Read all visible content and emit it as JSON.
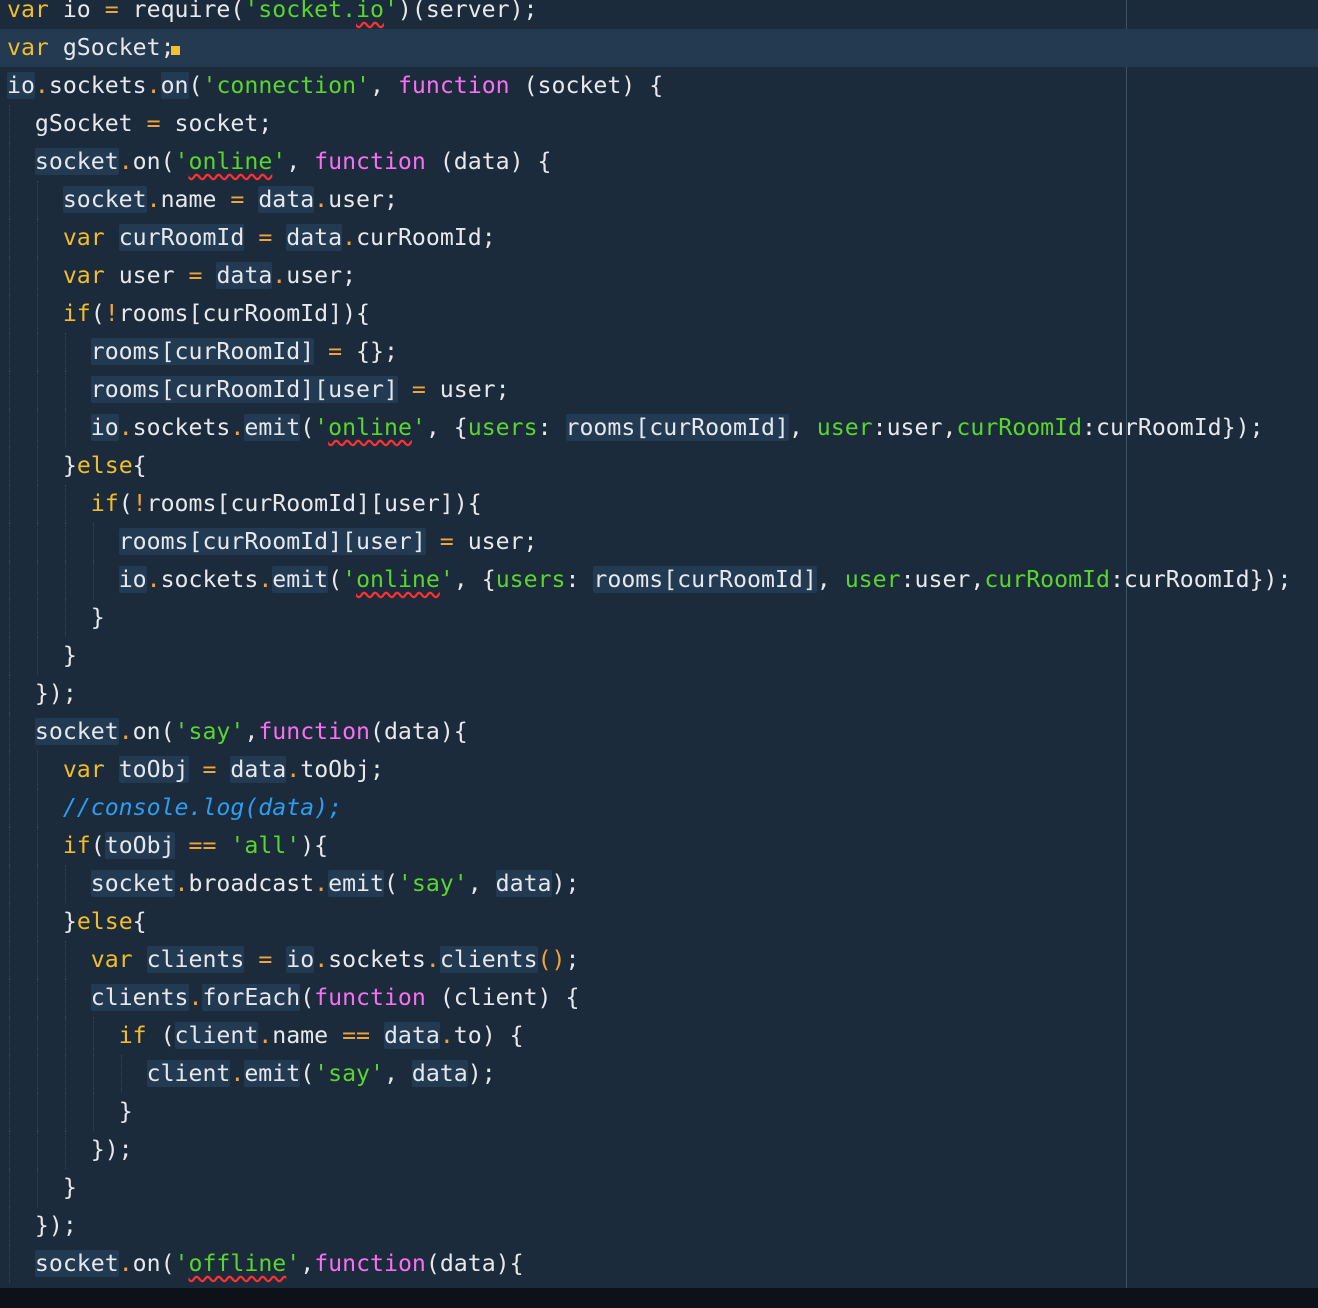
{
  "editor": {
    "ruler_visible": true,
    "current_line": 2,
    "colors": {
      "background": "#1b2b3b",
      "current_line": "#233a50",
      "keyword": "#f2bd2b",
      "function_keyword": "#f76ff2",
      "string": "#5ad42f",
      "comment": "#2c9df0",
      "operator": "#f0a53a",
      "spelling_squiggle": "#ff3030"
    },
    "lines": [
      {
        "indent": 0,
        "tokens": [
          [
            "kw",
            "var"
          ],
          [
            "t",
            " io "
          ],
          [
            "op",
            "="
          ],
          [
            "t",
            " require("
          ],
          [
            "str",
            "'socket."
          ],
          [
            "str err",
            "io"
          ],
          [
            "str",
            "'"
          ],
          [
            "t",
            ")(server);"
          ]
        ]
      },
      {
        "indent": 0,
        "tokens": [
          [
            "kw",
            "var"
          ],
          [
            "t",
            " gSocket;"
          ]
        ]
      },
      {
        "indent": 0,
        "tokens": [
          [
            "hl",
            "io"
          ],
          [
            "op",
            "."
          ],
          [
            "t",
            "sockets"
          ],
          [
            "op",
            "."
          ],
          [
            "hl",
            "on"
          ],
          [
            "t",
            "("
          ],
          [
            "str",
            "'connection'"
          ],
          [
            "t",
            ", "
          ],
          [
            "fn",
            "function"
          ],
          [
            "t",
            " (socket) {"
          ]
        ]
      },
      {
        "indent": 1,
        "tokens": [
          [
            "t",
            "gSocket "
          ],
          [
            "op",
            "="
          ],
          [
            "t",
            " socket;"
          ]
        ]
      },
      {
        "indent": 1,
        "tokens": [
          [
            "hl",
            "socket"
          ],
          [
            "op",
            "."
          ],
          [
            "t",
            "on("
          ],
          [
            "str",
            "'"
          ],
          [
            "str err",
            "online"
          ],
          [
            "str",
            "'"
          ],
          [
            "t",
            ", "
          ],
          [
            "fn",
            "function"
          ],
          [
            "t",
            " (data) {"
          ]
        ]
      },
      {
        "indent": 2,
        "tokens": [
          [
            "hl",
            "socket"
          ],
          [
            "op",
            "."
          ],
          [
            "t",
            "name "
          ],
          [
            "op",
            "="
          ],
          [
            "t",
            " "
          ],
          [
            "hl",
            "data"
          ],
          [
            "op",
            "."
          ],
          [
            "t",
            "user;"
          ]
        ]
      },
      {
        "indent": 2,
        "tokens": [
          [
            "kw",
            "var"
          ],
          [
            "t",
            " "
          ],
          [
            "hl",
            "curRoomId"
          ],
          [
            "t",
            " "
          ],
          [
            "op",
            "="
          ],
          [
            "t",
            " "
          ],
          [
            "hl",
            "data"
          ],
          [
            "op",
            "."
          ],
          [
            "t",
            "curRoomId;"
          ]
        ]
      },
      {
        "indent": 2,
        "tokens": [
          [
            "kw",
            "var"
          ],
          [
            "t",
            " user "
          ],
          [
            "op",
            "="
          ],
          [
            "t",
            " "
          ],
          [
            "hl",
            "data"
          ],
          [
            "op",
            "."
          ],
          [
            "t",
            "user;"
          ]
        ]
      },
      {
        "indent": 2,
        "tokens": [
          [
            "kw",
            "if"
          ],
          [
            "t",
            "("
          ],
          [
            "op",
            "!"
          ],
          [
            "t",
            "rooms[curRoomId]){"
          ]
        ]
      },
      {
        "indent": 3,
        "tokens": [
          [
            "hl",
            "rooms[curRoomId]"
          ],
          [
            "t",
            " "
          ],
          [
            "op",
            "="
          ],
          [
            "t",
            " {};"
          ]
        ]
      },
      {
        "indent": 3,
        "tokens": [
          [
            "hl",
            "rooms[curRoomId][user]"
          ],
          [
            "t",
            " "
          ],
          [
            "op",
            "="
          ],
          [
            "t",
            " user;"
          ]
        ]
      },
      {
        "indent": 3,
        "tokens": [
          [
            "hl",
            "io"
          ],
          [
            "op",
            "."
          ],
          [
            "t",
            "sockets"
          ],
          [
            "op",
            "."
          ],
          [
            "hl",
            "emit"
          ],
          [
            "t",
            "("
          ],
          [
            "str",
            "'"
          ],
          [
            "str err",
            "online"
          ],
          [
            "str",
            "'"
          ],
          [
            "t",
            ", {"
          ],
          [
            "str",
            "users"
          ],
          [
            "t",
            ": "
          ],
          [
            "hl",
            "rooms[curRoomId]"
          ],
          [
            "t",
            ", "
          ],
          [
            "str",
            "user"
          ],
          [
            "t",
            ":user,"
          ],
          [
            "str",
            "curRoomId"
          ],
          [
            "t",
            ":curRoomId});"
          ]
        ]
      },
      {
        "indent": 2,
        "tokens": [
          [
            "t",
            "}"
          ],
          [
            "kw",
            "else"
          ],
          [
            "t",
            "{"
          ]
        ]
      },
      {
        "indent": 3,
        "tokens": [
          [
            "kw",
            "if"
          ],
          [
            "t",
            "("
          ],
          [
            "op",
            "!"
          ],
          [
            "t",
            "rooms[curRoomId][user]){"
          ]
        ]
      },
      {
        "indent": 4,
        "tokens": [
          [
            "hl",
            "rooms[curRoomId][user]"
          ],
          [
            "t",
            " "
          ],
          [
            "op",
            "="
          ],
          [
            "t",
            " user;"
          ]
        ]
      },
      {
        "indent": 4,
        "tokens": [
          [
            "hl",
            "io"
          ],
          [
            "op",
            "."
          ],
          [
            "t",
            "sockets"
          ],
          [
            "op",
            "."
          ],
          [
            "hl",
            "emit"
          ],
          [
            "t",
            "("
          ],
          [
            "str",
            "'"
          ],
          [
            "str err",
            "online"
          ],
          [
            "str",
            "'"
          ],
          [
            "t",
            ", {"
          ],
          [
            "str",
            "users"
          ],
          [
            "t",
            ": "
          ],
          [
            "hl",
            "rooms[curRoomId]"
          ],
          [
            "t",
            ", "
          ],
          [
            "str",
            "user"
          ],
          [
            "t",
            ":user,"
          ],
          [
            "str",
            "curRoomId"
          ],
          [
            "t",
            ":curRoomId});"
          ]
        ]
      },
      {
        "indent": 3,
        "tokens": [
          [
            "t",
            "}"
          ]
        ]
      },
      {
        "indent": 2,
        "tokens": [
          [
            "t",
            "}"
          ]
        ]
      },
      {
        "indent": 1,
        "tokens": [
          [
            "t",
            "});"
          ]
        ]
      },
      {
        "indent": 1,
        "tokens": [
          [
            "hl",
            "socket"
          ],
          [
            "op",
            "."
          ],
          [
            "t",
            "on("
          ],
          [
            "str",
            "'say'"
          ],
          [
            "t",
            ","
          ],
          [
            "fn",
            "function"
          ],
          [
            "t",
            "(data){"
          ]
        ]
      },
      {
        "indent": 2,
        "tokens": [
          [
            "kw",
            "var"
          ],
          [
            "t",
            " "
          ],
          [
            "hl",
            "toObj"
          ],
          [
            "t",
            " "
          ],
          [
            "op",
            "="
          ],
          [
            "t",
            " "
          ],
          [
            "hl",
            "data"
          ],
          [
            "op",
            "."
          ],
          [
            "t",
            "toObj;"
          ]
        ]
      },
      {
        "indent": 2,
        "tokens": [
          [
            "cmt",
            "//console.log(data);"
          ]
        ]
      },
      {
        "indent": 2,
        "tokens": [
          [
            "kw",
            "if"
          ],
          [
            "t",
            "("
          ],
          [
            "hl",
            "toObj"
          ],
          [
            "t",
            " "
          ],
          [
            "op",
            "=="
          ],
          [
            "t",
            " "
          ],
          [
            "str",
            "'all'"
          ],
          [
            "t",
            "){"
          ]
        ]
      },
      {
        "indent": 3,
        "tokens": [
          [
            "hl",
            "socket"
          ],
          [
            "op",
            "."
          ],
          [
            "t",
            "broadcast"
          ],
          [
            "op",
            "."
          ],
          [
            "hl",
            "emit"
          ],
          [
            "t",
            "("
          ],
          [
            "str",
            "'say'"
          ],
          [
            "t",
            ", "
          ],
          [
            "hl",
            "data"
          ],
          [
            "t",
            ");"
          ]
        ]
      },
      {
        "indent": 2,
        "tokens": [
          [
            "t",
            "}"
          ],
          [
            "kw",
            "else"
          ],
          [
            "t",
            "{"
          ]
        ]
      },
      {
        "indent": 3,
        "tokens": [
          [
            "kw",
            "var"
          ],
          [
            "t",
            " "
          ],
          [
            "hl",
            "clients"
          ],
          [
            "t",
            " "
          ],
          [
            "op",
            "="
          ],
          [
            "t",
            " "
          ],
          [
            "hl",
            "io"
          ],
          [
            "op",
            "."
          ],
          [
            "t",
            "sockets"
          ],
          [
            "op",
            "."
          ],
          [
            "hl",
            "clients"
          ],
          [
            "op",
            "()"
          ],
          [
            "t",
            ";"
          ]
        ]
      },
      {
        "indent": 3,
        "tokens": [
          [
            "hl",
            "clients"
          ],
          [
            "op",
            "."
          ],
          [
            "hl",
            "forEach"
          ],
          [
            "t",
            "("
          ],
          [
            "fn",
            "function"
          ],
          [
            "t",
            " (client) {"
          ]
        ]
      },
      {
        "indent": 4,
        "tokens": [
          [
            "kw",
            "if"
          ],
          [
            "t",
            " ("
          ],
          [
            "hl",
            "client"
          ],
          [
            "op",
            "."
          ],
          [
            "t",
            "name "
          ],
          [
            "op",
            "=="
          ],
          [
            "t",
            " "
          ],
          [
            "hl",
            "data"
          ],
          [
            "op",
            "."
          ],
          [
            "t",
            "to) {"
          ]
        ]
      },
      {
        "indent": 5,
        "tokens": [
          [
            "hl",
            "client"
          ],
          [
            "op",
            "."
          ],
          [
            "hl",
            "emit"
          ],
          [
            "t",
            "("
          ],
          [
            "str",
            "'say'"
          ],
          [
            "t",
            ", "
          ],
          [
            "hl",
            "data"
          ],
          [
            "t",
            ");"
          ]
        ]
      },
      {
        "indent": 4,
        "tokens": [
          [
            "t",
            "}"
          ]
        ]
      },
      {
        "indent": 3,
        "tokens": [
          [
            "t",
            "});"
          ]
        ]
      },
      {
        "indent": 2,
        "tokens": [
          [
            "t",
            "}"
          ]
        ]
      },
      {
        "indent": 1,
        "tokens": [
          [
            "t",
            "});"
          ]
        ]
      },
      {
        "indent": 1,
        "tokens": [
          [
            "hl",
            "socket"
          ],
          [
            "op",
            "."
          ],
          [
            "t",
            "on("
          ],
          [
            "str",
            "'"
          ],
          [
            "str err",
            "offline"
          ],
          [
            "str",
            "'"
          ],
          [
            "t",
            ","
          ],
          [
            "fn",
            "function"
          ],
          [
            "t",
            "(data){"
          ]
        ]
      }
    ]
  }
}
